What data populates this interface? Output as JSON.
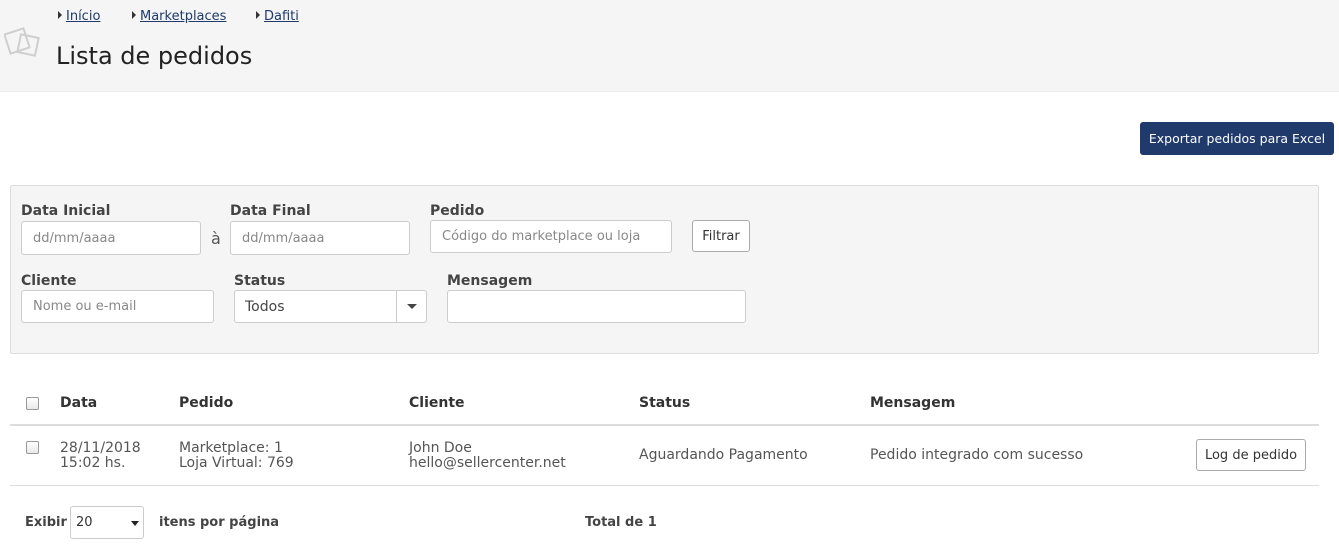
{
  "breadcrumb": [
    {
      "label": "Início"
    },
    {
      "label": "Marketplaces"
    },
    {
      "label": "Dafiti"
    }
  ],
  "page_title": "Lista de pedidos",
  "export_button": "Exportar pedidos para Excel",
  "filters": {
    "data_inicial": {
      "label": "Data Inicial",
      "placeholder": "dd/mm/aaaa"
    },
    "separator": "à",
    "data_final": {
      "label": "Data Final",
      "placeholder": "dd/mm/aaaa"
    },
    "pedido": {
      "label": "Pedido",
      "placeholder": "Código do marketplace ou loja"
    },
    "filtrar_button": "Filtrar",
    "cliente": {
      "label": "Cliente",
      "placeholder": "Nome ou e-mail"
    },
    "status": {
      "label": "Status",
      "value": "Todos"
    },
    "mensagem": {
      "label": "Mensagem",
      "value": ""
    }
  },
  "table": {
    "headers": [
      "Data",
      "Pedido",
      "Cliente",
      "Status",
      "Mensagem"
    ],
    "rows": [
      {
        "date": "28/11/2018",
        "time": "15:02 hs.",
        "pedido_marketplace": "Marketplace: 1",
        "pedido_loja": "Loja Virtual: 769",
        "cliente_nome": "John Doe",
        "cliente_email": "hello@sellercenter.net",
        "status": "Aguardando Pagamento",
        "mensagem": "Pedido integrado com sucesso",
        "action": "Log de pedido"
      }
    ]
  },
  "pagination": {
    "exibir_label": "Exibir",
    "per_page": "20",
    "itens_label": "itens por página",
    "total": "Total de 1"
  },
  "colors": {
    "primary": "#1f3a6b",
    "header_bg": "#f5f5f5",
    "filter_bg": "#f5f5f5"
  }
}
